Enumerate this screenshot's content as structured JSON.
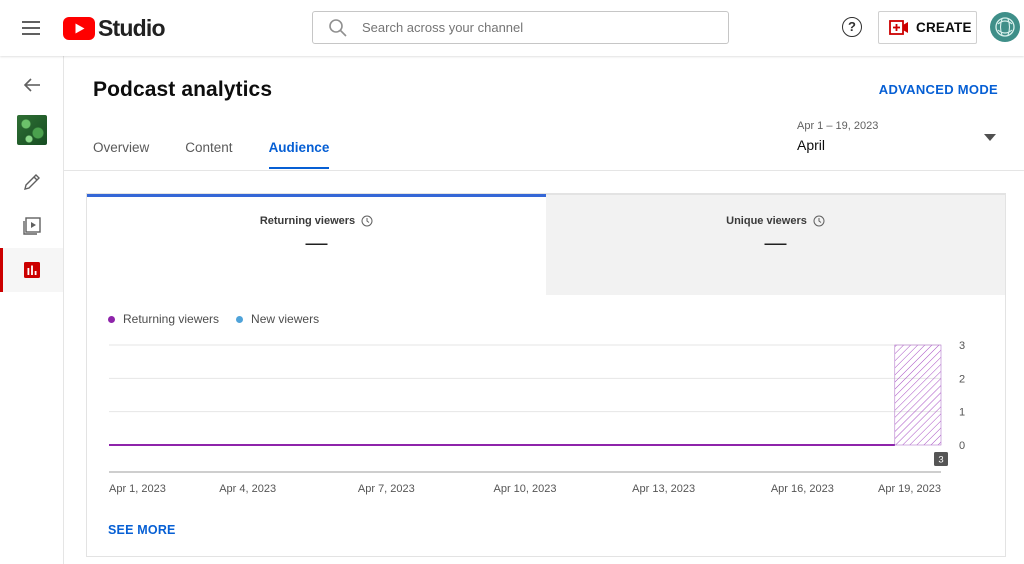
{
  "app": {
    "name": "Studio"
  },
  "search": {
    "placeholder": "Search across your channel"
  },
  "header": {
    "help_label": "?",
    "create_label": "CREATE"
  },
  "page": {
    "title": "Podcast analytics",
    "advanced_mode": "ADVANCED MODE",
    "tabs": [
      {
        "label": "Overview",
        "active": false
      },
      {
        "label": "Content",
        "active": false
      },
      {
        "label": "Audience",
        "active": true
      }
    ],
    "date_range": "Apr 1 – 19, 2023",
    "date_label": "April"
  },
  "metrics": [
    {
      "title": "Returning viewers",
      "value": "—",
      "active": true
    },
    {
      "title": "Unique viewers",
      "value": "—",
      "active": false
    }
  ],
  "colors": {
    "returning": "#8e24aa",
    "new": "#4fa3d9",
    "accent": "#065fd4",
    "active_rail": "#cc0000"
  },
  "chart_data": {
    "type": "line",
    "x": [
      "Apr 1, 2023",
      "Apr 2, 2023",
      "Apr 3, 2023",
      "Apr 4, 2023",
      "Apr 5, 2023",
      "Apr 6, 2023",
      "Apr 7, 2023",
      "Apr 8, 2023",
      "Apr 9, 2023",
      "Apr 10, 2023",
      "Apr 11, 2023",
      "Apr 12, 2023",
      "Apr 13, 2023",
      "Apr 14, 2023",
      "Apr 15, 2023",
      "Apr 16, 2023",
      "Apr 17, 2023",
      "Apr 18, 2023",
      "Apr 19, 2023"
    ],
    "x_tick_labels": [
      "Apr 1, 2023",
      "Apr 4, 2023",
      "Apr 7, 2023",
      "Apr 10, 2023",
      "Apr 13, 2023",
      "Apr 16, 2023",
      "Apr 19, 2023"
    ],
    "series": [
      {
        "name": "Returning viewers",
        "values": [
          0,
          0,
          0,
          0,
          0,
          0,
          0,
          0,
          0,
          0,
          0,
          0,
          0,
          0,
          0,
          0,
          0,
          0,
          0
        ]
      },
      {
        "name": "New viewers",
        "values": [
          0,
          0,
          0,
          0,
          0,
          0,
          0,
          0,
          0,
          0,
          0,
          0,
          0,
          0,
          0,
          0,
          0,
          0,
          0
        ]
      }
    ],
    "y_ticks": [
      0,
      1,
      2,
      3
    ],
    "ylim": [
      0,
      3
    ],
    "y_axis_side": "right",
    "incomplete_period": {
      "from": "Apr 18, 2023",
      "to": "Apr 19, 2023",
      "style": "hatched"
    },
    "marker_label": "3",
    "grid": true
  },
  "see_more": "SEE MORE"
}
